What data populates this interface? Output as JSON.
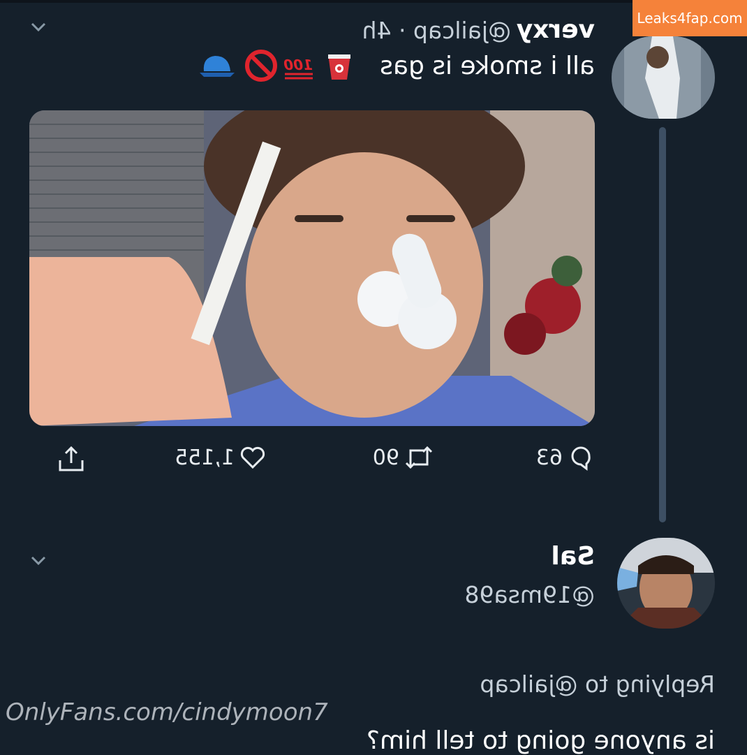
{
  "tweet": {
    "display_name": "verxy",
    "handle": "@jailcap · 4h",
    "text": "all i smoke is gas",
    "emoji": [
      "red-cup-emoji",
      "hundred-emoji",
      "no-entry-emoji",
      "blue-cap-emoji"
    ],
    "actions": {
      "replies": "63",
      "retweets": "90",
      "likes": "1,155"
    }
  },
  "reply": {
    "display_name": "Sal",
    "handle": "@19msa98",
    "replying_to": "Replying to @jailcap",
    "text": "is anyone going to tell him?"
  },
  "watermarks": {
    "site": "Leaks4fap.com",
    "onlyfans": "OnlyFans.com/cindymoon7"
  },
  "colors": {
    "background": "#15202b",
    "handle": "#c6d0d9",
    "link": "#1d9bf0",
    "watermark": "#f5823a"
  }
}
